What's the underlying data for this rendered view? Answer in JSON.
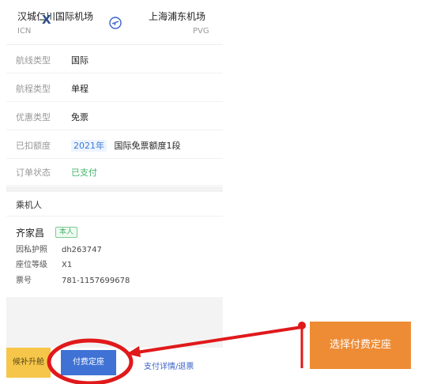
{
  "route": {
    "from_city": "汉城仁川国际机场",
    "from_code": "ICN",
    "to_city": "上海浦东机场",
    "to_code": "PVG"
  },
  "details": [
    {
      "label": "航线类型",
      "value": "国际"
    },
    {
      "label": "航程类型",
      "value": "单程"
    },
    {
      "label": "优惠类型",
      "value": "免票"
    },
    {
      "label": "已扣额度",
      "year": "2021年",
      "value": "国际免票额度1段"
    },
    {
      "label": "订单状态",
      "value": "已支付"
    }
  ],
  "passenger": {
    "section_title": "乘机人",
    "name": "齐家昌",
    "tag": "本人",
    "fields": [
      {
        "label": "因私护照",
        "value": "dh263747"
      },
      {
        "label": "座位等级",
        "value": "X1"
      },
      {
        "label": "票号",
        "value": "781-1157699678"
      }
    ]
  },
  "actions": {
    "waitlist_upgrade": "候补升舱",
    "paid_seat": "付费定座",
    "payment_details": "支付详情/退票"
  },
  "annotation": {
    "label": "选择付费定座"
  },
  "colors": {
    "primary_button": "#3f72d4",
    "waitlist_button": "#f6c64a",
    "annotation_box": "#ee8c35",
    "annotation_mark": "#e0191b",
    "paid_status": "#46b46a"
  }
}
